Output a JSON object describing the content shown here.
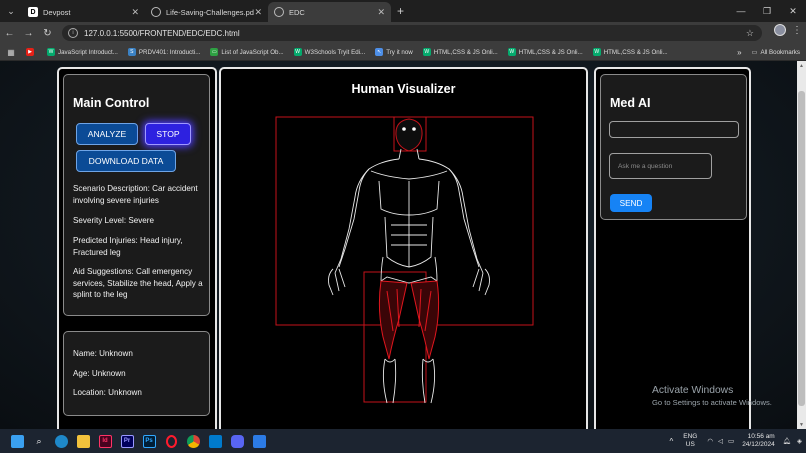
{
  "browser": {
    "tabs": [
      {
        "label": "Devpost",
        "favicon": "D",
        "active": false
      },
      {
        "label": "Life-Saving-Challenges.pdf",
        "favicon": "globe-icon",
        "active": false
      },
      {
        "label": "EDC",
        "favicon": "globe-icon",
        "active": true
      }
    ],
    "url": "127.0.0.1:5500/FRONTEND/EDC/EDC.html",
    "bookmarks": [
      {
        "label": "",
        "icon": "youtube-icon",
        "color": "#e62117"
      },
      {
        "label": "JavaScript Introduct...",
        "icon": "w3-icon",
        "color": "#04aa6d"
      },
      {
        "label": "PRDV401: Introducti...",
        "icon": "saylor-icon",
        "color": "#3b82c4"
      },
      {
        "label": "List of JavaScript Ob...",
        "icon": "screen-icon",
        "color": "#2ea043"
      },
      {
        "label": "W3Schools Tryit Edi...",
        "icon": "w3-icon",
        "color": "#04aa6d"
      },
      {
        "label": "Try it now",
        "icon": "cursor-icon",
        "color": "#4d8fe8"
      },
      {
        "label": "HTML,CSS & JS Onli...",
        "icon": "w3-icon",
        "color": "#04aa6d"
      },
      {
        "label": "HTML,CSS & JS Onli...",
        "icon": "w3-icon",
        "color": "#04aa6d"
      },
      {
        "label": "HTML,CSS & JS Onli...",
        "icon": "w3-icon",
        "color": "#04aa6d"
      }
    ],
    "all_bookmarks": "All Bookmarks"
  },
  "main_control": {
    "title": "Main Control",
    "analyze": "ANALYZE",
    "stop": "STOP",
    "download": "DOWNLOAD DATA",
    "scenario": "Scenario Description: Car accident involving severe injuries",
    "severity": "Severity Level: Severe",
    "injuries": "Predicted Injuries: Head injury, Fractured leg",
    "aid": "Aid Suggestions: Call emergency services, Stabilize the head, Apply a splint to the leg"
  },
  "patient": {
    "name": "Name: Unknown",
    "age": "Age: Unknown",
    "location": "Location: Unknown"
  },
  "visualizer": {
    "title": "Human Visualizer",
    "highlighted_regions": [
      "head",
      "legs"
    ],
    "highlight_color": "#e0161e"
  },
  "med_ai": {
    "title": "Med AI",
    "input_value": "",
    "question_placeholder": "Ask me a question",
    "send": "SEND"
  },
  "watermark": {
    "line1": "Activate Windows",
    "line2": "Go to Settings to activate Windows."
  },
  "taskbar": {
    "lang1": "ENG",
    "lang2": "US",
    "time": "10:56 am",
    "date": "24/12/2024"
  },
  "colors": {
    "accent_blue": "#0b4b96",
    "stop_purple": "#2d21e0",
    "send_blue": "#1683f5"
  }
}
